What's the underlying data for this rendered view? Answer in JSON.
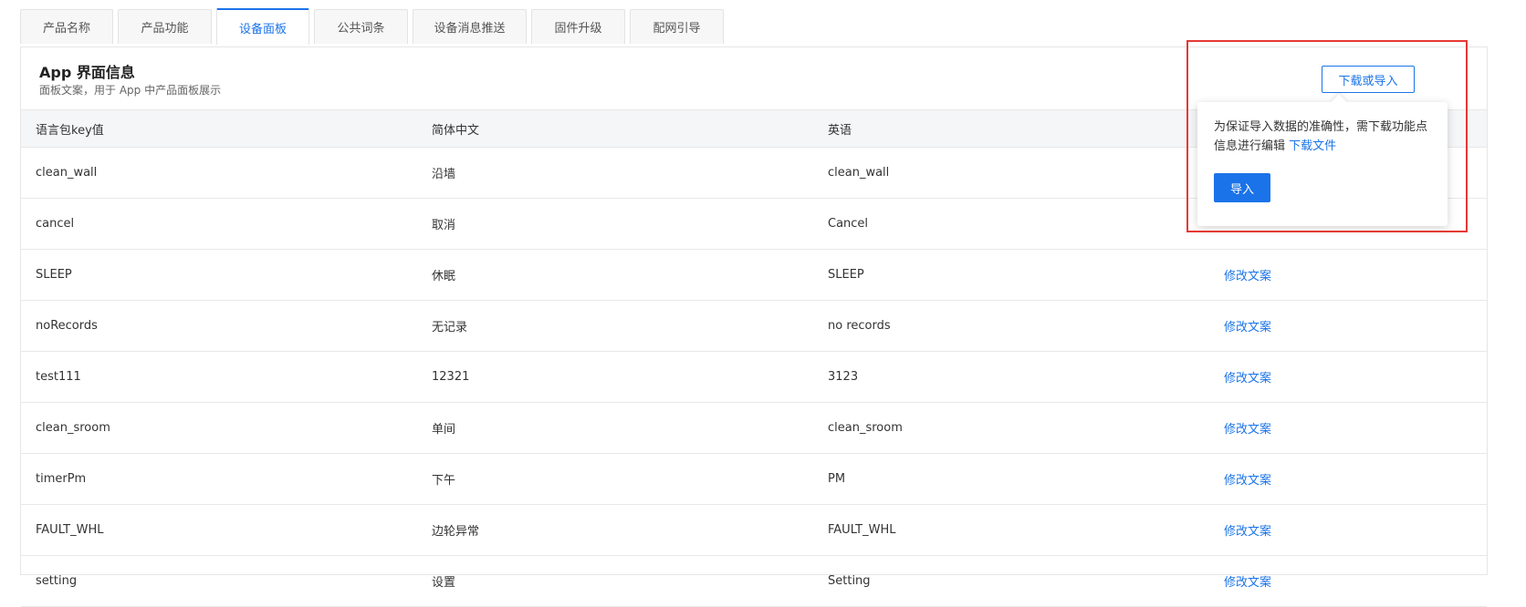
{
  "tabs": [
    "产品名称",
    "产品功能",
    "设备面板",
    "公共词条",
    "设备消息推送",
    "固件升级",
    "配网引导"
  ],
  "active_tab": "设备面板",
  "section": {
    "title": "App 界面信息",
    "subtitle": "面板文案，用于 App 中产品面板展示",
    "download_import_label": "下载或导入"
  },
  "table": {
    "headers": [
      "语言包key值",
      "简体中文",
      "英语",
      ""
    ],
    "rows": [
      [
        "clean_wall",
        "沿墙",
        "clean_wall",
        ""
      ],
      [
        "cancel",
        "取消",
        "Cancel",
        ""
      ],
      [
        "SLEEP",
        "休眠",
        "SLEEP",
        "修改文案"
      ],
      [
        "noRecords",
        "无记录",
        "no records",
        "修改文案"
      ],
      [
        "test111",
        "12321",
        "3123",
        "修改文案"
      ],
      [
        "clean_sroom",
        "单间",
        "clean_sroom",
        "修改文案"
      ],
      [
        "timerPm",
        "下午",
        "PM",
        "修改文案"
      ],
      [
        "FAULT_WHL",
        "边轮异常",
        "FAULT_WHL",
        "修改文案"
      ],
      [
        "setting",
        "设置",
        "Setting",
        "修改文案"
      ]
    ]
  },
  "popover": {
    "text": "为保证导入数据的准确性，需下载功能点信息进行编辑",
    "link": "下载文件",
    "import_label": "导入"
  },
  "colors": {
    "accent": "#1a73e8",
    "highlight": "#e53935"
  }
}
